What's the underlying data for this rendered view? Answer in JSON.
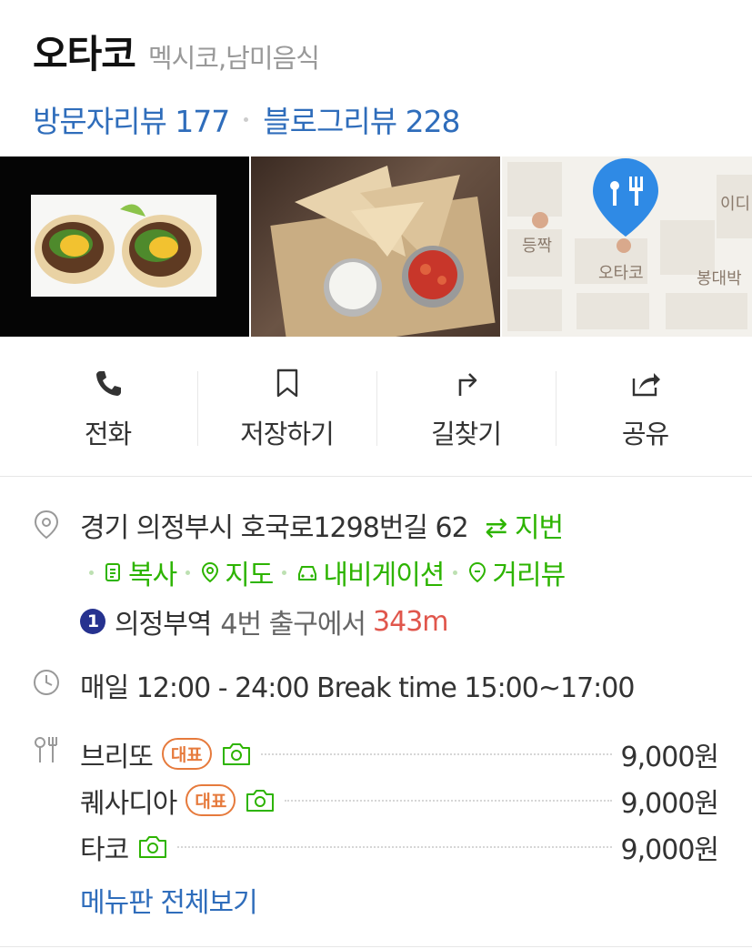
{
  "place": {
    "name": "오타코",
    "category": "멕시코,남미음식",
    "visitor_review": "방문자리뷰 177",
    "blog_review": "블로그리뷰 228"
  },
  "map": {
    "labels": [
      "이디",
      "등짝",
      "오타코",
      "봉대박"
    ]
  },
  "actions": [
    {
      "label": "전화",
      "icon": "phone-icon"
    },
    {
      "label": "저장하기",
      "icon": "bookmark-icon"
    },
    {
      "label": "길찾기",
      "icon": "directions-icon"
    },
    {
      "label": "공유",
      "icon": "share-icon"
    }
  ],
  "address": {
    "text": "경기 의정부시 호국로1298번길 62",
    "lot_toggle": "⇄ 지번",
    "links": [
      "복사",
      "지도",
      "내비게이션",
      "거리뷰"
    ]
  },
  "subway": {
    "line": "1",
    "station": "의정부역",
    "exit": "4번 출구에서",
    "distance": "343m"
  },
  "hours": "매일 12:00 - 24:00 Break time 15:00~17:00",
  "menu": {
    "items": [
      {
        "name": "브리또",
        "badge": "대표",
        "price": "9,000원"
      },
      {
        "name": "퀘사디아",
        "badge": "대표",
        "price": "9,000원"
      },
      {
        "name": "타코",
        "badge": "",
        "price": "9,000원"
      }
    ],
    "view_all": "메뉴판 전체보기"
  },
  "colors": {
    "link_blue": "#2f6dbb",
    "naver_green": "#2db400",
    "badge_orange": "#e67a3c",
    "distance_red": "#e0564c",
    "line1_navy": "#26328f",
    "map_pin_blue": "#2f8ae5"
  }
}
